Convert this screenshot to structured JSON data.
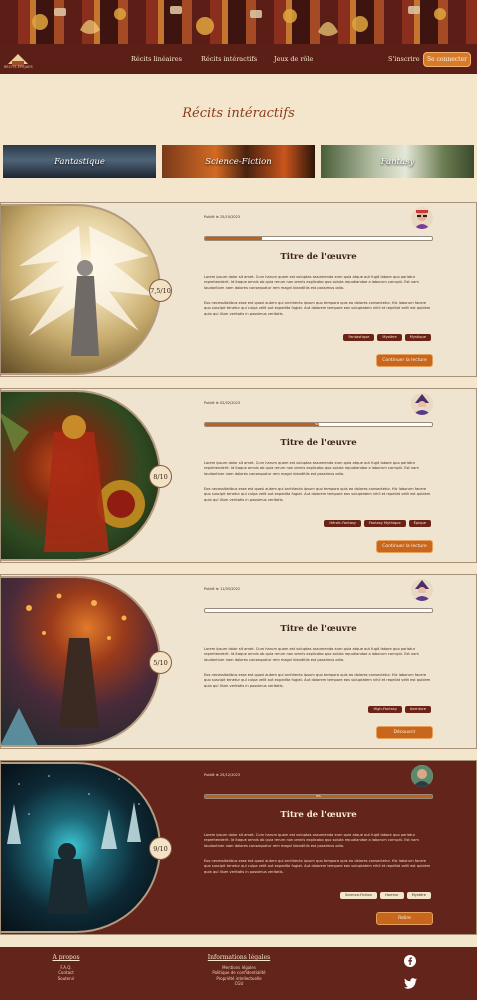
{
  "nav": {
    "logo_text": "RÉCITS ÉPIQUES",
    "links": [
      "Récits linéaires",
      "Récits intéractifs",
      "Jeux de rôle"
    ],
    "register": "S'inscrire",
    "login": "Se connecter"
  },
  "page_title": "Récits intéractifs",
  "genres": [
    "Fantastique",
    "Science-Fiction",
    "Fantasy"
  ],
  "lorem1": "Lorem ipsum dolor sit amet. Cum harum quam est voluptas assumenda eum quia atque aut fugit labore quo pariatur reprehenderit. Id itaque omnis ab quia rerum non omnis explicabo quo soluta repudiandae a laborum corrupti. Est nam laudantium nam dolores consequatur rem magni blanditiis est possimus odio.",
  "lorem2": "Eos necessitatibus esse est quasi autem qui architecto ipsum quo tempora quis eo dolores consectetur. Hic laborum facere quo suscipit tenetur qui culpa velit aut expedita fugiat. Aut dolorem tempore eos voluptatem nihil et repellat velit est quidem quia qui illum veritatis in possimus veritatis.",
  "cards": [
    {
      "date": "Publié le 25/10/2023",
      "score": "7,5/10",
      "progress_label": "25%",
      "progress": 0.25,
      "title": "Titre de l'œuvre",
      "tags": [
        "Fantastique",
        "Mystère",
        "Mystique"
      ],
      "cta": "Continuer la lecture"
    },
    {
      "date": "Publié le 02/02/2023",
      "score": "8/10",
      "progress_label": "50%",
      "progress": 0.5,
      "title": "Titre de l'œuvre",
      "tags": [
        "Héroïc-Fantasy",
        "Fantasy Mythique",
        "Épique"
      ],
      "cta": "Continuer la lecture"
    },
    {
      "date": "Publié le 11/03/2022",
      "score": "5/10",
      "progress_label": "",
      "progress": 0,
      "title": "Titre de l'œuvre",
      "tags": [
        "High-Fantasy",
        "Aventure"
      ],
      "cta": "Découvrir"
    },
    {
      "date": "Publié le 25/12/2023",
      "score": "9/10",
      "progress_label": "0%",
      "progress": 1,
      "title": "Titre de l'œuvre",
      "tags": [
        "Science-Fiction",
        "Horreur",
        "Mystère"
      ],
      "cta": "Relire"
    }
  ],
  "footer": {
    "about_title": "A propos",
    "about_links": [
      "F.A.Q.",
      "Contact",
      "Soutenir"
    ],
    "legal_title": "Informations légales",
    "legal_links": [
      "Mentions légales",
      "Politique de confidentialité",
      "Propriété intellectuelle",
      "CGU"
    ],
    "icons": [
      "facebook-icon",
      "twitter-icon"
    ]
  },
  "colors": {
    "accent": "#c8661e",
    "dark": "#63241b",
    "paper": "#f3e6cc"
  }
}
